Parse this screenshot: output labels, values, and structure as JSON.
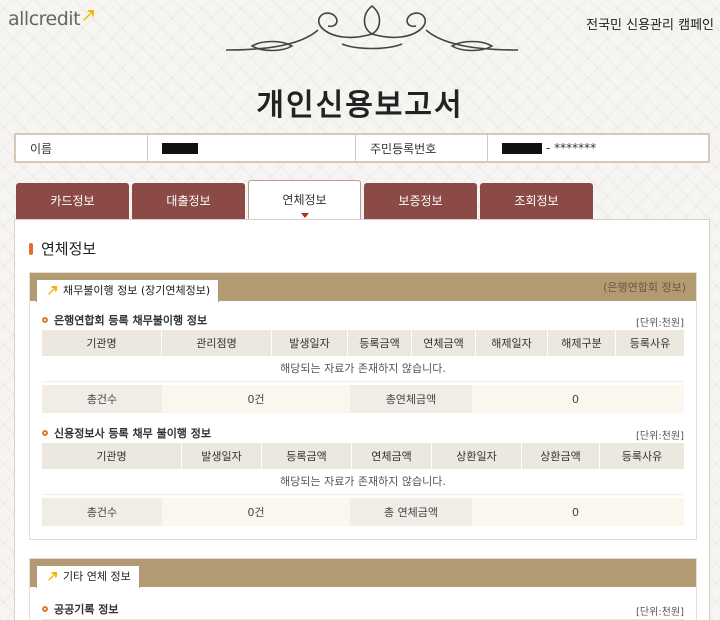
{
  "header": {
    "logo_text": "allcredit",
    "campaign": "전국민 신용관리 캠페인",
    "title": "개인신용보고서"
  },
  "identity": {
    "name_label": "이름",
    "id_label": "주민등록번호",
    "id_suffix": "- *******"
  },
  "tabs": [
    {
      "label": "카드정보",
      "active": false
    },
    {
      "label": "대출정보",
      "active": false
    },
    {
      "label": "연체정보",
      "active": true
    },
    {
      "label": "보증정보",
      "active": false
    },
    {
      "label": "조회정보",
      "active": false
    }
  ],
  "section_title": "연체정보",
  "box1": {
    "tab_label": "채무불이행 정보 (장기연체정보)",
    "right_label": "(은행연합회 정보)",
    "table1": {
      "title": "은행연합회 등록 채무불이행 정보",
      "unit": "[단위:천원]",
      "headers": [
        "기관명",
        "관리점명",
        "발생일자",
        "등록금액",
        "연체금액",
        "해제일자",
        "해제구분",
        "등록사유"
      ],
      "empty_text": "해당되는 자료가 존재하지 않습니다.",
      "summary": {
        "count_label": "총건수",
        "count_value": "0건",
        "amount_label": "총연체금액",
        "amount_value": "0"
      }
    },
    "table2": {
      "title": "신용정보사 등록 채무 불이행 정보",
      "unit": "[단위:천원]",
      "headers": [
        "기관명",
        "발생일자",
        "등록금액",
        "연체금액",
        "상환일자",
        "상환금액",
        "등록사유"
      ],
      "empty_text": "해당되는 자료가 존재하지 않습니다.",
      "summary": {
        "count_label": "총건수",
        "count_value": "0건",
        "amount_label": "총 연체금액",
        "amount_value": "0"
      }
    }
  },
  "box2": {
    "tab_label": "기타 연체 정보",
    "table": {
      "title": "공공기록 정보",
      "unit": "[단위:천원]"
    }
  },
  "colors": {
    "tab": "#8b4a46",
    "box_header": "#b29a72",
    "accent": "#e46d2a"
  }
}
